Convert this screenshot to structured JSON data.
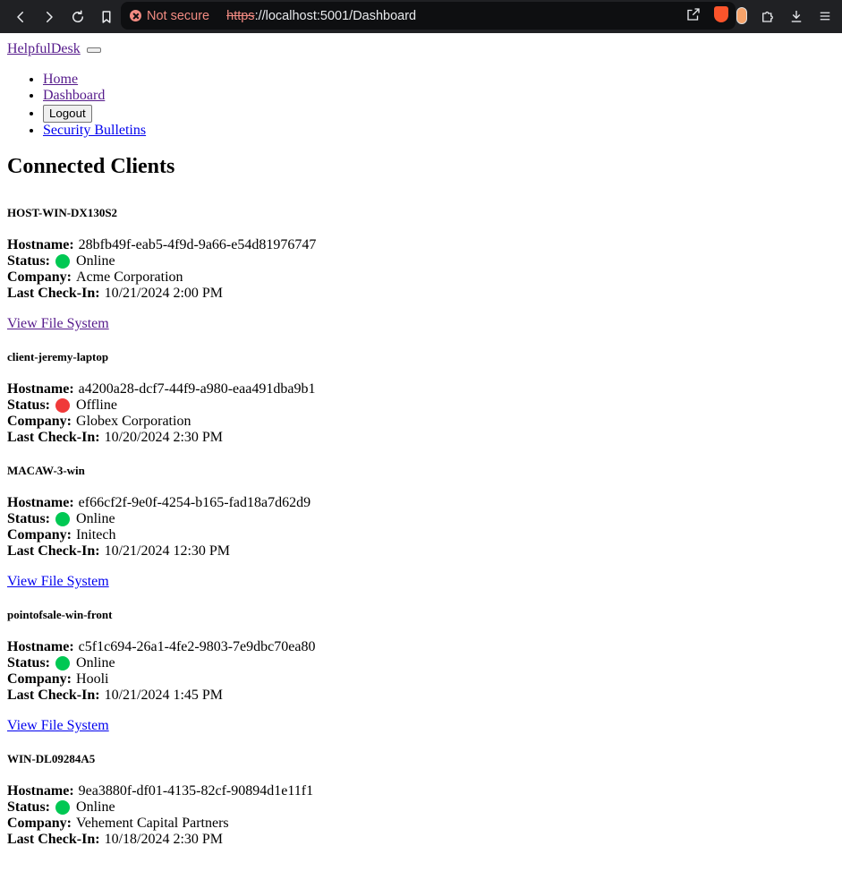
{
  "browser": {
    "not_secure_label": "Not secure",
    "url_protocol": "https",
    "url_rest": "://localhost:5001/Dashboard"
  },
  "nav": {
    "brand": "HelpfulDesk",
    "items": [
      {
        "label": "Home",
        "type": "link",
        "visited": true
      },
      {
        "label": "Dashboard",
        "type": "link",
        "visited": true
      },
      {
        "label": "Logout",
        "type": "button"
      },
      {
        "label": "Security Bulletins",
        "type": "link",
        "visited": false
      }
    ]
  },
  "page": {
    "title": "Connected Clients"
  },
  "labels": {
    "hostname": "Hostname:",
    "status": "Status:",
    "company": "Company:",
    "last_checkin": "Last Check-In:",
    "view_fs": "View File System"
  },
  "colors": {
    "online": "#00c853",
    "offline": "#f03a3a"
  },
  "clients": [
    {
      "name": "HOST-WIN-DX130S2",
      "hostname": "28bfb49f-eab5-4f9d-9a66-e54d81976747",
      "status": "Online",
      "company": "Acme Corporation",
      "last_checkin": "10/21/2024 2:00 PM",
      "has_fs_link": true,
      "fs_visited": true
    },
    {
      "name": "client-jeremy-laptop",
      "hostname": "a4200a28-dcf7-44f9-a980-eaa491dba9b1",
      "status": "Offline",
      "company": "Globex Corporation",
      "last_checkin": "10/20/2024 2:30 PM",
      "has_fs_link": false
    },
    {
      "name": "MACAW-3-win",
      "hostname": "ef66cf2f-9e0f-4254-b165-fad18a7d62d9",
      "status": "Online",
      "company": "Initech",
      "last_checkin": "10/21/2024 12:30 PM",
      "has_fs_link": true,
      "fs_visited": false
    },
    {
      "name": "pointofsale-win-front",
      "hostname": "c5f1c694-26a1-4fe2-9803-7e9dbc70ea80",
      "status": "Online",
      "company": "Hooli",
      "last_checkin": "10/21/2024 1:45 PM",
      "has_fs_link": true,
      "fs_visited": false
    },
    {
      "name": "WIN-DL09284A5",
      "hostname": "9ea3880f-df01-4135-82cf-90894d1e11f1",
      "status": "Online",
      "company": "Vehement Capital Partners",
      "last_checkin": "10/18/2024 2:30 PM",
      "has_fs_link": false
    }
  ]
}
